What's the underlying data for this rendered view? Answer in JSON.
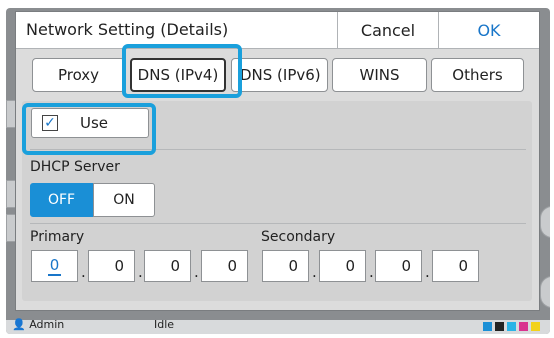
{
  "dialog": {
    "title": "Network Setting (Details)",
    "cancel_label": "Cancel",
    "ok_label": "OK"
  },
  "tabs": [
    {
      "label": "Proxy",
      "active": false
    },
    {
      "label": "DNS (IPv4)",
      "active": true
    },
    {
      "label": "DNS (IPv6)",
      "active": false
    },
    {
      "label": "WINS",
      "active": false
    },
    {
      "label": "Others",
      "active": false
    }
  ],
  "use": {
    "label": "Use",
    "checked": true
  },
  "dhcp": {
    "label": "DHCP Server",
    "off_label": "OFF",
    "on_label": "ON",
    "selected": "OFF"
  },
  "primary": {
    "label": "Primary",
    "octets": [
      "0",
      "0",
      "0",
      "0"
    ]
  },
  "secondary": {
    "label": "Secondary",
    "octets": [
      "0",
      "0",
      "0",
      "0"
    ]
  },
  "statusbar": {
    "user": "Admin",
    "state": "Idle"
  },
  "colors": {
    "accent": "#1a8fd6",
    "highlight": "#1aa0dc",
    "ok_text": "#1976c9"
  }
}
